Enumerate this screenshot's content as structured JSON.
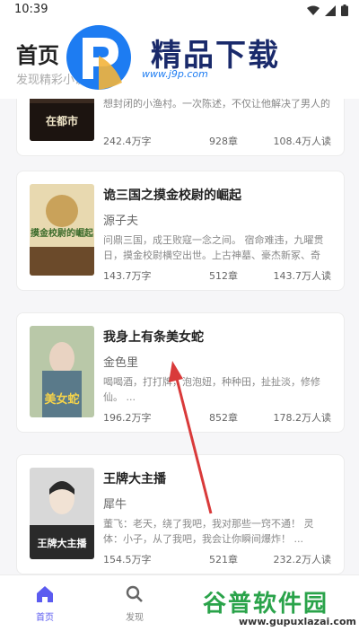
{
  "status_bar": {
    "time": "10:39"
  },
  "header": {
    "title": "首页",
    "subtitle": "发现精彩小说"
  },
  "logo": {
    "name": "精品下载",
    "url": "www.j9p.com",
    "color": "#1a2a6b"
  },
  "books": [
    {
      "title": "",
      "author": "",
      "cover_text": "在都市",
      "desc": "想封闭的小渔村。一次陈述，不仅让他解决了男人的",
      "words": "242.4万字",
      "chapters": "928章",
      "readers": "108.4万人读"
    },
    {
      "title": "诡三国之摸金校尉的崛起",
      "author": "源子夫",
      "cover_text": "摸金校尉的崛起",
      "desc": "问鼎三国，成王败寇一念之间。 宿命难违，九曜贯日，摸金校尉横空出世。上古神墓、豪杰新冢、奇谈...",
      "words": "143.7万字",
      "chapters": "512章",
      "readers": "143.7万人读"
    },
    {
      "title": "我身上有条美女蛇",
      "author": "金色里",
      "cover_text": "美女蛇",
      "desc": "喝喝酒，打打牌，泡泡妞，种种田，扯扯淡，修修仙。 ...",
      "words": "196.2万字",
      "chapters": "852章",
      "readers": "178.2万人读"
    },
    {
      "title": "王牌大主播",
      "author": "犀牛",
      "cover_text": "王牌大主播",
      "desc": "董飞：老天，绕了我吧，我对那些一窍不通！ 灵体：小子，从了我吧，我会让你瞬间爆炸！ ...",
      "words": "154.5万字",
      "chapters": "521章",
      "readers": "232.2万人读"
    }
  ],
  "nav": [
    {
      "label": "首页",
      "icon": "home-icon",
      "active": true
    },
    {
      "label": "发现",
      "icon": "search-icon",
      "active": false
    }
  ],
  "watermark": {
    "title": "谷普软件园",
    "url": "www.gupuxlazai.com"
  },
  "colors": {
    "accent": "#5b5bf0",
    "arrow": "#d93a3a"
  }
}
